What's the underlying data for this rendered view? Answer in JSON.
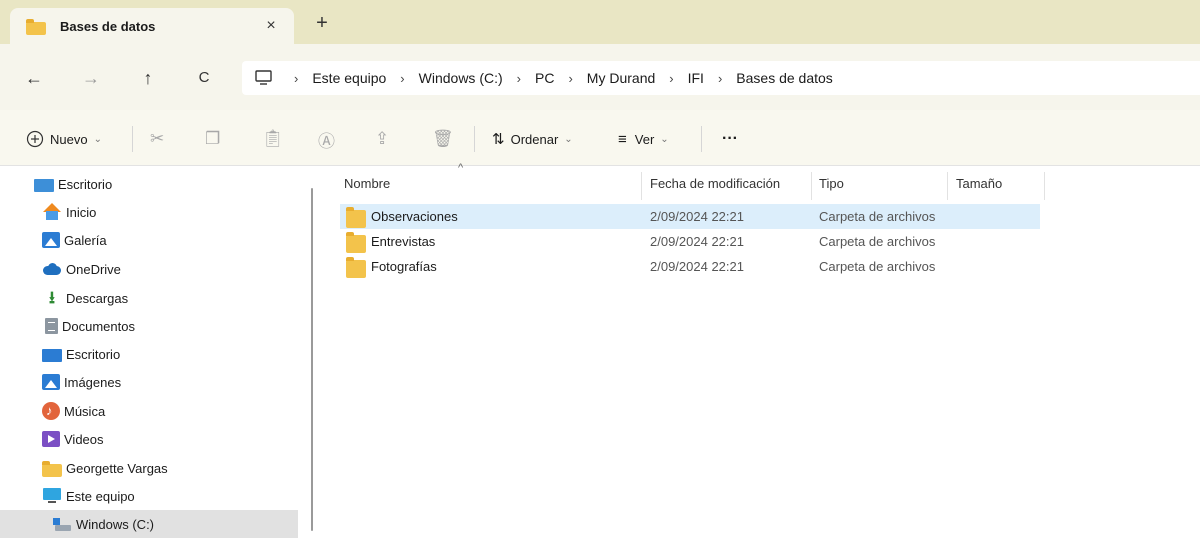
{
  "tab": {
    "title": "Bases de datos",
    "close": "×",
    "new_tab": "+"
  },
  "nav": {
    "back": "←",
    "forward": "→",
    "up": "↑",
    "refresh": "C"
  },
  "breadcrumbs": [
    "Este equipo",
    "Windows (C:)",
    "PC",
    "My Durand",
    "IFI",
    "Bases de datos"
  ],
  "breadcrumb_separator": "›",
  "toolbar": {
    "new_label": "Nuevo",
    "sort_label": "Ordenar",
    "view_label": "Ver",
    "more_label": "···"
  },
  "sidebar": {
    "items": [
      {
        "label": "Escritorio",
        "icon": "desktop-icon"
      },
      {
        "label": "Inicio",
        "icon": "home-icon"
      },
      {
        "label": "Galería",
        "icon": "gallery-icon"
      },
      {
        "label": "OneDrive",
        "icon": "cloud-icon"
      },
      {
        "label": "Descargas",
        "icon": "download-icon"
      },
      {
        "label": "Documentos",
        "icon": "document-icon"
      },
      {
        "label": "Escritorio",
        "icon": "desktop-icon"
      },
      {
        "label": "Imágenes",
        "icon": "pictures-icon"
      },
      {
        "label": "Música",
        "icon": "music-icon"
      },
      {
        "label": "Videos",
        "icon": "video-icon"
      },
      {
        "label": "Georgette Vargas",
        "icon": "folder-icon"
      },
      {
        "label": "Este equipo",
        "icon": "computer-icon"
      },
      {
        "label": "Windows (C:)",
        "icon": "drive-icon"
      }
    ],
    "selected": "Windows (C:)"
  },
  "columns": {
    "name": "Nombre",
    "date": "Fecha de modificación",
    "type": "Tipo",
    "size": "Tamaño"
  },
  "files": [
    {
      "name": "Observaciones",
      "date": "2/09/2024 22:21",
      "type": "Carpeta de archivos",
      "size": ""
    },
    {
      "name": "Entrevistas",
      "date": "2/09/2024 22:21",
      "type": "Carpeta de archivos",
      "size": ""
    },
    {
      "name": "Fotografías",
      "date": "2/09/2024 22:21",
      "type": "Carpeta de archivos",
      "size": ""
    }
  ],
  "colors": {
    "tabstrip": "#e9e6c4",
    "selection": "#dceefb",
    "folder": "#f3c34b"
  }
}
